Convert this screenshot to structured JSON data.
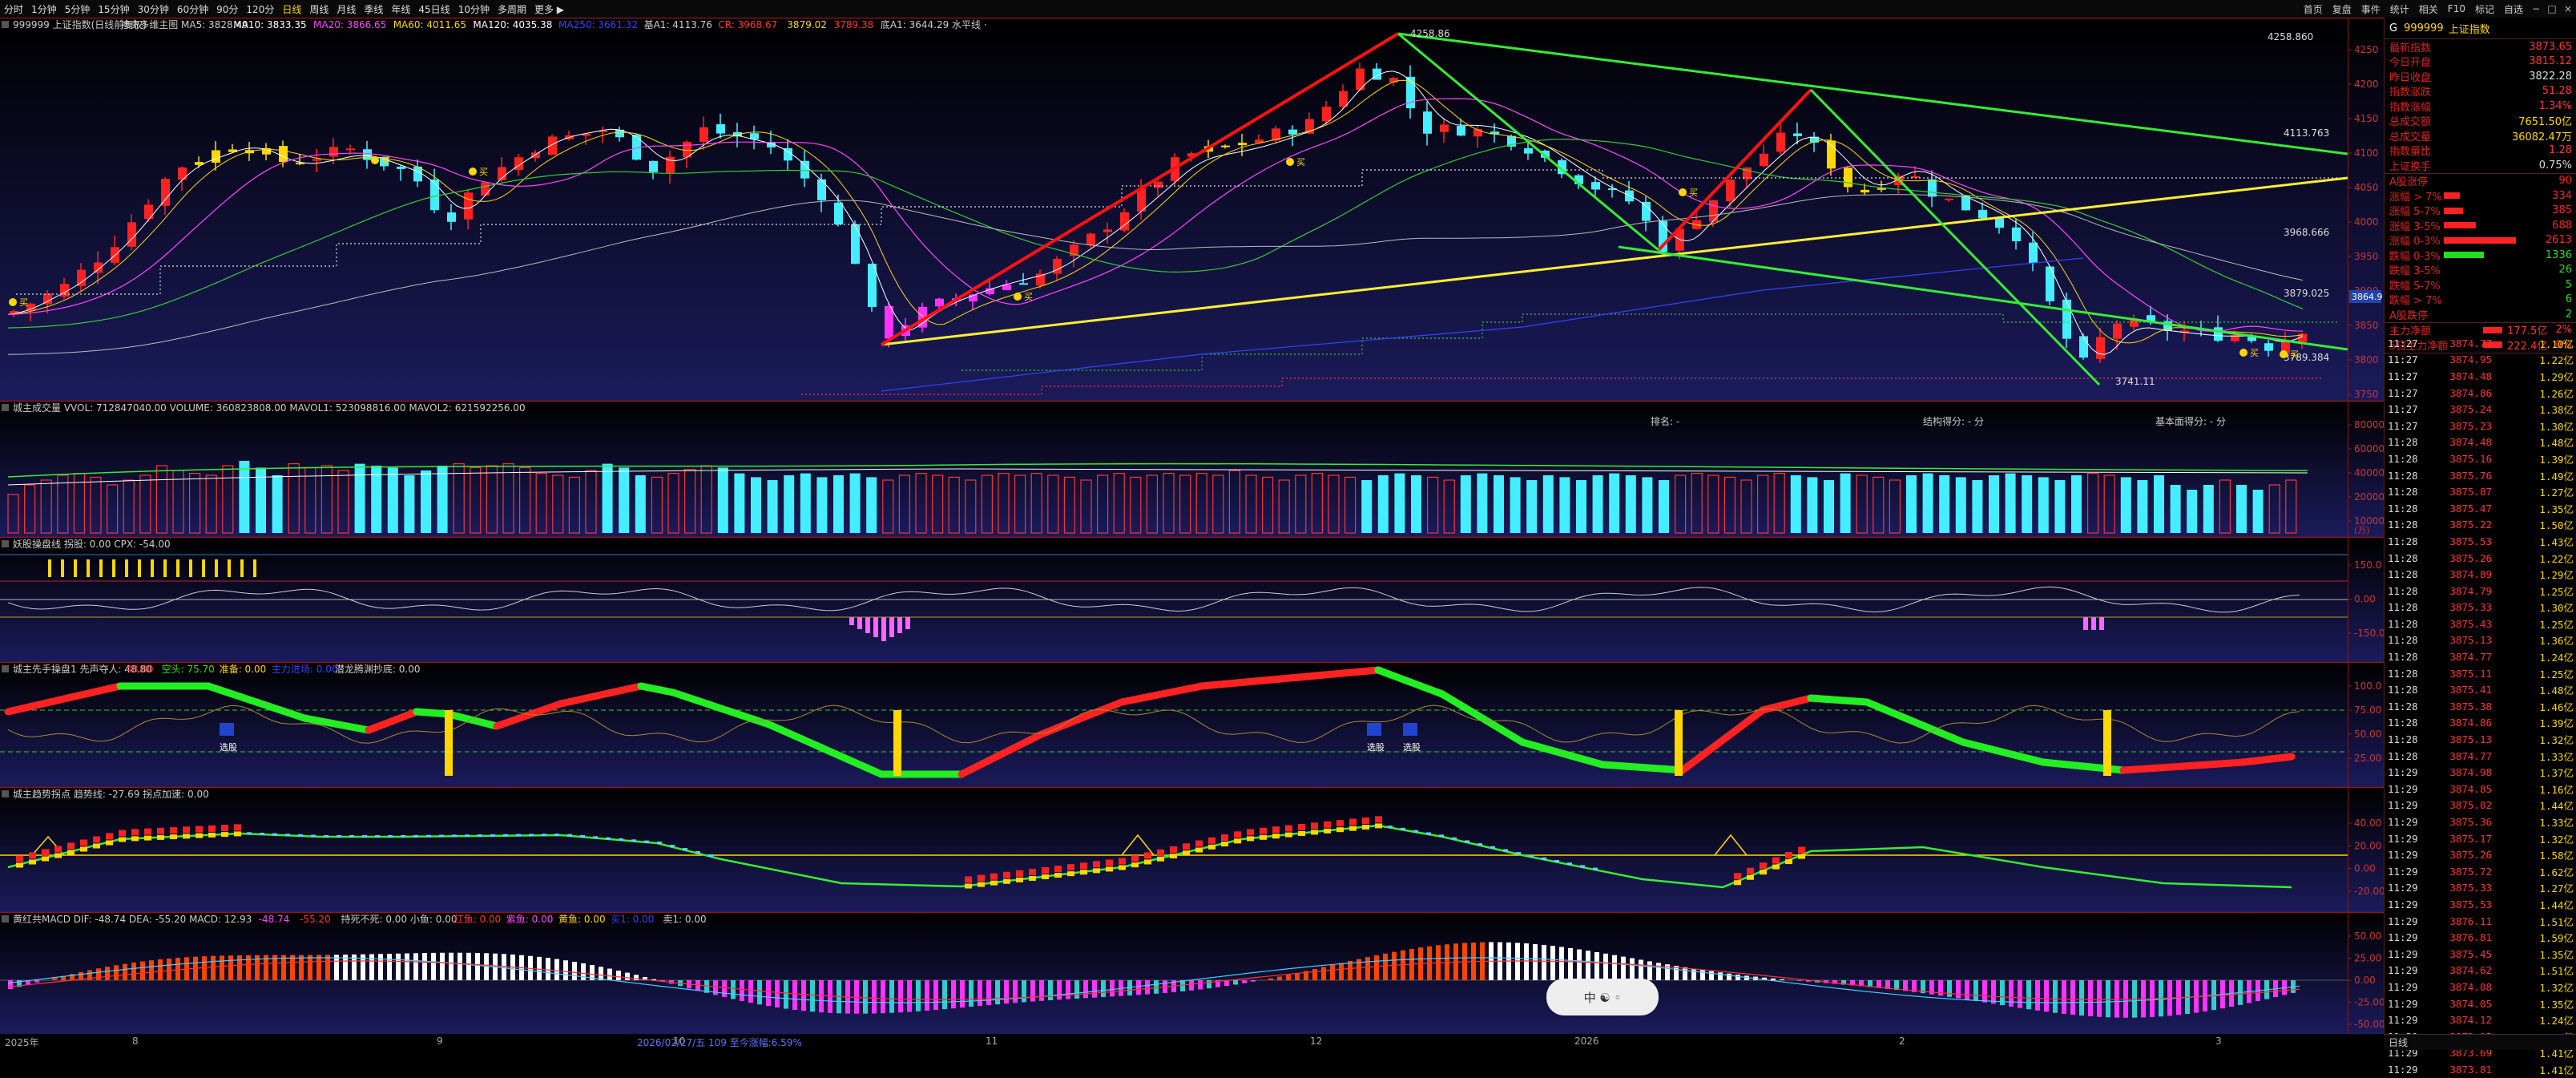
{
  "toolbar": {
    "timeframes": [
      "分时",
      "1分钟",
      "5分钟",
      "15分钟",
      "30分钟",
      "60分钟",
      "90分",
      "120分",
      "日线",
      "周线",
      "月线",
      "季线",
      "年线",
      "45日线",
      "10分钟",
      "多周期",
      "更多 ▶"
    ],
    "active_timeframe": "日线",
    "right_buttons": [
      "首页",
      "复盘",
      "事件",
      "统计",
      "相关",
      "F10",
      "标记",
      "自选"
    ]
  },
  "main": {
    "caption_parts": [
      {
        "text": "999999 上证指数(日线前复权)",
        "color": "#cccccc"
      },
      {
        "text": "神奇多维主图 MA5: 3828.49",
        "color": "#cccccc"
      },
      {
        "text": "MA10: 3833.35",
        "color": "#ffffff"
      },
      {
        "text": "MA20: 3866.65",
        "color": "#ff44ff"
      },
      {
        "text": "MA60: 4011.65",
        "color": "#ffd700"
      },
      {
        "text": "MA120: 4035.38",
        "color": "#ffffff"
      },
      {
        "text": "MA250: 3661.32",
        "color": "#3344ff"
      },
      {
        "text": "基A1: 4113.76",
        "color": "#cccccc"
      },
      {
        "text": "CR: 3968.67",
        "color": "#ff3333"
      },
      {
        "text": "3879.02",
        "color": "#ffd700"
      },
      {
        "text": "3789.38",
        "color": "#ff3333"
      },
      {
        "text": "底A1: 3644.29 水平线 ·",
        "color": "#cccccc"
      }
    ],
    "yticks": [
      "4250",
      "4200",
      "4150",
      "4100",
      "4050",
      "4000",
      "3950",
      "3900",
      "3850",
      "3800",
      "3750"
    ],
    "annotations": [
      "4258.860",
      "4113.763",
      "3968.666",
      "3879.025",
      "3789.384",
      "3741.11",
      "4258.86"
    ],
    "price_tag": "3864.9",
    "buy_marks": [
      "买",
      "买",
      "买",
      "买",
      "买",
      "买",
      "买",
      "买"
    ]
  },
  "vol": {
    "caption": "城主成交量 VVOL: 712847040.00 VOLUME: 360823808.00 MAVOL1: 523098816.00 MAVOL2: 621592256.00",
    "labels": [
      "排名: -",
      "结构得分: - 分",
      "基本面得分: - 分"
    ],
    "yticks": [
      "80000",
      "60000",
      "40000",
      "20000",
      "10000"
    ],
    "unit": "(万)",
    "bars": [
      0.4,
      0.5,
      0.55,
      0.6,
      0.62,
      0.58,
      0.5,
      0.55,
      0.6,
      0.7,
      0.65,
      0.62,
      0.6,
      0.7,
      0.75,
      0.68,
      0.6,
      0.72,
      0.68,
      0.7,
      0.65,
      0.72,
      0.7,
      0.68,
      0.6,
      0.65,
      0.7,
      0.72,
      0.68,
      0.7,
      0.72,
      0.68,
      0.62,
      0.6,
      0.58,
      0.65,
      0.72,
      0.68,
      0.6,
      0.58,
      0.62,
      0.66,
      0.7,
      0.68,
      0.62,
      0.58,
      0.55,
      0.6,
      0.62,
      0.58,
      0.6,
      0.62,
      0.58,
      0.55,
      0.6,
      0.62,
      0.6,
      0.58,
      0.55,
      0.6,
      0.62,
      0.6,
      0.62,
      0.6,
      0.58,
      0.55,
      0.6,
      0.62,
      0.58,
      0.6,
      0.62,
      0.6,
      0.62,
      0.6,
      0.65,
      0.6,
      0.58,
      0.55,
      0.6,
      0.62,
      0.6,
      0.58,
      0.55,
      0.6,
      0.62,
      0.6,
      0.58,
      0.55,
      0.6,
      0.62,
      0.6,
      0.58,
      0.55,
      0.6,
      0.58,
      0.55,
      0.6,
      0.62,
      0.6,
      0.58,
      0.55,
      0.6,
      0.62,
      0.6,
      0.58,
      0.55,
      0.6,
      0.62,
      0.6,
      0.58,
      0.55,
      0.62,
      0.6,
      0.58,
      0.55,
      0.6,
      0.62,
      0.6,
      0.58,
      0.55,
      0.6,
      0.62,
      0.6,
      0.58,
      0.55,
      0.6,
      0.62,
      0.6,
      0.58,
      0.55,
      0.6,
      0.5,
      0.45,
      0.5,
      0.55,
      0.5,
      0.45,
      0.5,
      0.55,
      0.6,
      0.55
    ]
  },
  "ind2": {
    "caption": "妖股操盘线 拐股: 0.00 CPX: -54.00",
    "yticks": [
      "150.0",
      "0.00",
      "-150.0"
    ]
  },
  "ind3": {
    "caption_parts": [
      {
        "text": "城主先手操盘1 先声夺人: 48.80",
        "color": "#cccccc"
      },
      {
        "text": "48.80",
        "color": "#ff3333"
      },
      {
        "text": "空头: 75.70",
        "color": "#22dd22"
      },
      {
        "text": "准备: 0.00",
        "color": "#ffd700"
      },
      {
        "text": "主力进场: 0.00",
        "color": "#3344ff"
      },
      {
        "text": "潜龙腾渊抄底: 0.00",
        "color": "#cccccc"
      }
    ],
    "yticks": [
      "100.0",
      "75.00",
      "50.00",
      "25.00"
    ],
    "labels": [
      "选股",
      "选股",
      "选股"
    ]
  },
  "ind4": {
    "caption": "城主趋势拐点 趋势线: -27.69 拐点加速: 0.00",
    "yticks": [
      "40.00",
      "20.00",
      "0.00",
      "-20.00"
    ]
  },
  "ind5": {
    "caption_parts": [
      {
        "text": "黄红共MACD DIF: -48.74 DEA: -55.20 MACD: 12.93",
        "color": "#cccccc"
      },
      {
        "text": "-48.74",
        "color": "#ff44ff"
      },
      {
        "text": "-55.20",
        "color": "#ff3333"
      },
      {
        "text": "持死不死: 0.00 小鱼: 0.00",
        "color": "#cccccc"
      },
      {
        "text": "红鱼: 0.00",
        "color": "#ff3333"
      },
      {
        "text": "紫鱼: 0.00",
        "color": "#ff44ff"
      },
      {
        "text": "黄鱼: 0.00",
        "color": "#ffd700"
      },
      {
        "text": "买1: 0.00",
        "color": "#3344ff"
      },
      {
        "text": "卖1: 0.00",
        "color": "#cccccc"
      }
    ],
    "yticks": [
      "50.00",
      "25.00",
      "0.00",
      "-25.00",
      "-50.00"
    ]
  },
  "datebar": {
    "left": "2025年",
    "marks": [
      "8",
      "9",
      "10",
      "11",
      "12",
      "2026",
      "2",
      "3"
    ],
    "highlight": "2026/02/27/五 109 至今涨幅:6.59%"
  },
  "rightpanel": {
    "code": "999999",
    "name": "上证指数",
    "stats": [
      {
        "label": "最新指数",
        "value": "3873.65",
        "cls": "v"
      },
      {
        "label": "今日开盘",
        "value": "3815.12",
        "cls": "v"
      },
      {
        "label": "昨日收盘",
        "value": "3822.28",
        "cls": "v w"
      },
      {
        "label": "指数涨跌",
        "value": "51.28",
        "cls": "v"
      },
      {
        "label": "指数涨幅",
        "value": "1.34%",
        "cls": "v"
      },
      {
        "label": "总成交额",
        "value": "7651.50亿",
        "cls": "v y"
      },
      {
        "label": "总成交量",
        "value": "36082.47万",
        "cls": "v y"
      },
      {
        "label": "指数量比",
        "value": "1.28",
        "cls": "v"
      },
      {
        "label": "上证换手",
        "value": "0.75%",
        "cls": "v w"
      }
    ],
    "breadth": [
      {
        "label": "A股涨停",
        "value": "90",
        "w": 0,
        "c": "#ff2222"
      },
      {
        "label": "涨幅 > 7%",
        "value": "334",
        "w": 20,
        "c": "#ff2222"
      },
      {
        "label": "涨幅 5-7%",
        "value": "385",
        "w": 24,
        "c": "#ff2222"
      },
      {
        "label": "涨幅 3-5%",
        "value": "688",
        "w": 40,
        "c": "#ff2222"
      },
      {
        "label": "涨幅 0-3%",
        "value": "2613",
        "w": 90,
        "c": "#ff2222"
      },
      {
        "label": "跌幅 0-3%",
        "value": "1336",
        "w": 50,
        "c": "#22dd22"
      },
      {
        "label": "跌幅 3-5%",
        "value": "26",
        "w": 0,
        "c": "#22dd22"
      },
      {
        "label": "跌幅 5-7%",
        "value": "5",
        "w": 0,
        "c": "#22dd22"
      },
      {
        "label": "跌幅 > 7%",
        "value": "6",
        "w": 0,
        "c": "#22dd22"
      },
      {
        "label": "A股跌停",
        "value": "2",
        "w": 0,
        "c": "#22dd22"
      }
    ],
    "flow": [
      {
        "label": "主力净额",
        "value": "177.5亿",
        "pct": "2%"
      },
      {
        "label": "5日主力净额",
        "value": "222.4亿",
        "pct": "0%"
      }
    ],
    "ticks": [
      [
        "11:27",
        "3874.77",
        "1.10亿"
      ],
      [
        "11:27",
        "3874.95",
        "1.22亿"
      ],
      [
        "11:27",
        "3874.48",
        "1.29亿"
      ],
      [
        "11:27",
        "3874.86",
        "1.26亿"
      ],
      [
        "11:27",
        "3875.24",
        "1.38亿"
      ],
      [
        "11:27",
        "3875.23",
        "1.30亿"
      ],
      [
        "11:28",
        "3874.48",
        "1.48亿"
      ],
      [
        "11:28",
        "3875.16",
        "1.39亿"
      ],
      [
        "11:28",
        "3875.76",
        "1.49亿"
      ],
      [
        "11:28",
        "3875.87",
        "1.27亿"
      ],
      [
        "11:28",
        "3875.47",
        "1.35亿"
      ],
      [
        "11:28",
        "3875.22",
        "1.50亿"
      ],
      [
        "11:28",
        "3875.53",
        "1.43亿"
      ],
      [
        "11:28",
        "3875.26",
        "1.22亿"
      ],
      [
        "11:28",
        "3874.89",
        "1.29亿"
      ],
      [
        "11:28",
        "3874.79",
        "1.25亿"
      ],
      [
        "11:28",
        "3875.33",
        "1.30亿"
      ],
      [
        "11:28",
        "3875.43",
        "1.25亿"
      ],
      [
        "11:28",
        "3875.13",
        "1.36亿"
      ],
      [
        "11:28",
        "3874.77",
        "1.24亿"
      ],
      [
        "11:28",
        "3875.11",
        "1.25亿"
      ],
      [
        "11:28",
        "3875.41",
        "1.48亿"
      ],
      [
        "11:28",
        "3875.38",
        "1.46亿"
      ],
      [
        "11:28",
        "3874.86",
        "1.39亿"
      ],
      [
        "11:28",
        "3875.13",
        "1.32亿"
      ],
      [
        "11:28",
        "3874.77",
        "1.33亿"
      ],
      [
        "11:29",
        "3874.98",
        "1.37亿"
      ],
      [
        "11:29",
        "3874.85",
        "1.16亿"
      ],
      [
        "11:29",
        "3875.02",
        "1.44亿"
      ],
      [
        "11:29",
        "3875.36",
        "1.33亿"
      ],
      [
        "11:29",
        "3875.17",
        "1.32亿"
      ],
      [
        "11:29",
        "3875.26",
        "1.58亿"
      ],
      [
        "11:29",
        "3875.72",
        "1.62亿"
      ],
      [
        "11:29",
        "3875.33",
        "1.27亿"
      ],
      [
        "11:29",
        "3875.53",
        "1.44亿"
      ],
      [
        "11:29",
        "3876.11",
        "1.51亿"
      ],
      [
        "11:29",
        "3876.81",
        "1.59亿"
      ],
      [
        "11:29",
        "3875.45",
        "1.35亿"
      ],
      [
        "11:29",
        "3874.62",
        "1.51亿"
      ],
      [
        "11:29",
        "3874.08",
        "1.32亿"
      ],
      [
        "11:29",
        "3874.05",
        "1.35亿"
      ],
      [
        "11:29",
        "3874.12",
        "1.24亿"
      ],
      [
        "11:29",
        "3873.95",
        "1.17亿"
      ],
      [
        "11:29",
        "3873.69",
        "1.41亿"
      ],
      [
        "11:29",
        "3873.81",
        "1.41亿"
      ]
    ],
    "bottom_tab": "日线"
  },
  "widget": {
    "label": "中 ☯ ◦"
  },
  "colors": {
    "up": "#ff2222",
    "down": "#44eeff",
    "bg_top": "#000000",
    "bg_bottom": "#1a1a5a",
    "yellow": "#ffd700",
    "green": "#33ee33"
  }
}
